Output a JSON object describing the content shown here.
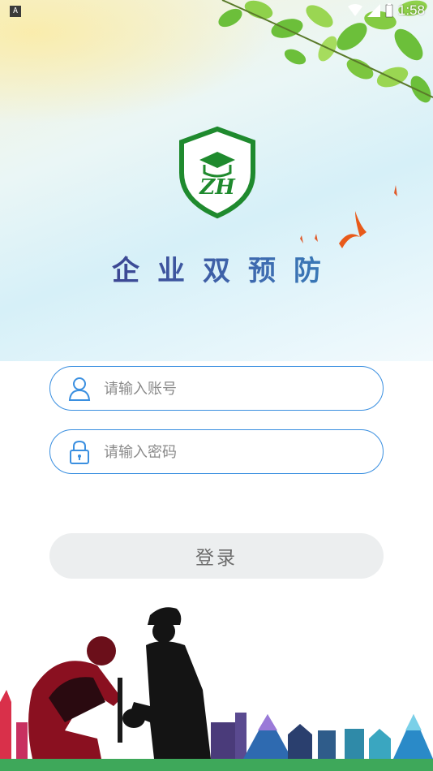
{
  "status_bar": {
    "left_badge": "A",
    "time": "1:58"
  },
  "app": {
    "title": "企业双预防"
  },
  "form": {
    "account_placeholder": "请输入账号",
    "account_value": "",
    "password_placeholder": "请输入密码",
    "password_value": "",
    "login_label": "登录"
  },
  "icons": {
    "status": [
      "wifi-icon",
      "signal-icon",
      "battery-icon"
    ],
    "account": "user-icon",
    "password": "lock-icon",
    "logo": "shield-logo-icon"
  },
  "colors": {
    "field_border": "#3a8fe0",
    "logo_green": "#1f8a2e",
    "title_start": "#3b2a7c",
    "title_end": "#2e8fc0",
    "button_bg": "#eceeef"
  }
}
